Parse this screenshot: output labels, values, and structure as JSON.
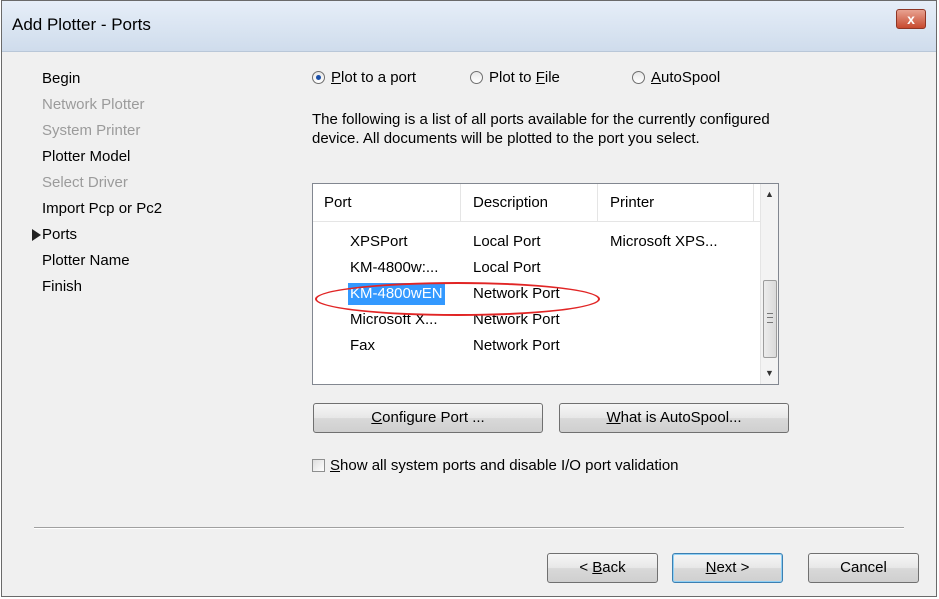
{
  "window": {
    "title": "Add Plotter - Ports",
    "close_label": "x"
  },
  "steps": [
    {
      "label": "Begin",
      "state": "enabled"
    },
    {
      "label": "Network Plotter",
      "state": "disabled"
    },
    {
      "label": "System Printer",
      "state": "disabled"
    },
    {
      "label": "Plotter Model",
      "state": "enabled"
    },
    {
      "label": "Select Driver",
      "state": "disabled"
    },
    {
      "label": "Import Pcp or Pc2",
      "state": "enabled"
    },
    {
      "label": "Ports",
      "state": "current"
    },
    {
      "label": "Plotter Name",
      "state": "enabled"
    },
    {
      "label": "Finish",
      "state": "enabled"
    }
  ],
  "output_options": {
    "selected": "plot_to_port",
    "plot_to_port": {
      "pre": "",
      "key": "P",
      "post": "lot to a port"
    },
    "plot_to_file": {
      "pre": "Plot to ",
      "key": "F",
      "post": "ile"
    },
    "autospool": {
      "pre": "",
      "key": "A",
      "post": "utoSpool"
    }
  },
  "description": "The following is a list of all ports available for the currently configured device. All documents will be plotted to the port you select.",
  "ports_list": {
    "columns": [
      "Port",
      "Description",
      "Printer"
    ],
    "rows": [
      {
        "port": "XPSPort",
        "description": "Local Port",
        "printer": "Microsoft XPS..."
      },
      {
        "port": "KM-4800w:...",
        "description": "Local Port",
        "printer": ""
      },
      {
        "port": "KM-4800wEN",
        "description": "Network Port",
        "printer": "",
        "selected": true
      },
      {
        "port": "Microsoft X...",
        "description": "Network Port",
        "printer": ""
      },
      {
        "port": "Fax",
        "description": "Network Port",
        "printer": ""
      }
    ],
    "highlight_color": "#e12525",
    "selection_color": "#3399ff"
  },
  "buttons": {
    "configure_port": {
      "key": "C",
      "post": "onfigure Port ..."
    },
    "what_is_autospool": {
      "key": "W",
      "post": "hat is AutoSpool..."
    },
    "back": {
      "pre": "< ",
      "key": "B",
      "post": "ack"
    },
    "next": {
      "key": "N",
      "post": "ext >"
    },
    "cancel": "Cancel"
  },
  "show_all_ports": {
    "checked": false,
    "key": "S",
    "post": "how all system ports and disable I/O port validation"
  }
}
